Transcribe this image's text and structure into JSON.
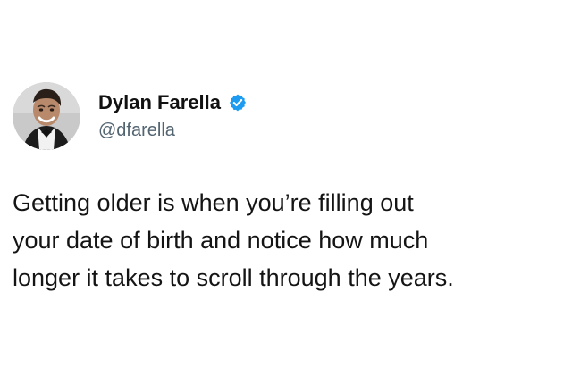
{
  "author": {
    "display_name": "Dylan Farella",
    "handle": "@dfarella",
    "verified": true,
    "verified_icon": "verified-badge-icon",
    "avatar": "profile-photo"
  },
  "tweet": {
    "lines": [
      "Getting older is when you’re filling out",
      "your date of birth and notice how much",
      "longer it takes to scroll through the years."
    ]
  },
  "colors": {
    "background": "#ffffff",
    "text": "#141414",
    "handle": "#536471",
    "verified": "#1d9bf0"
  }
}
